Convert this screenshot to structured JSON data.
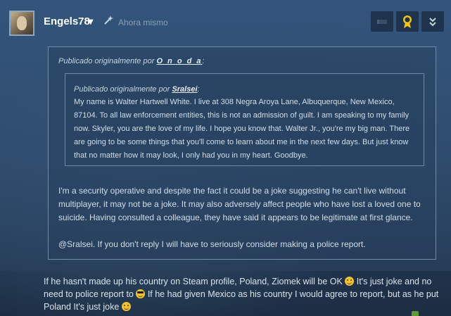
{
  "post": {
    "username": "Engels78",
    "timestamp": "Ahora mismo",
    "icons": {
      "status": "wand-icon",
      "rate": "thumbs-down-icon",
      "award": "award-ribbon-icon",
      "more": "chevron-double-down-icon"
    },
    "colors": {
      "award": "#f0c419",
      "username": "#ffffff",
      "timestamp": "#8b9fb2"
    }
  },
  "outer_quote": {
    "prefix": "Publicado originalmente por",
    "author": "O n o d a",
    "suffix": ":",
    "inner_quote": {
      "prefix": "Publicado originalmente por",
      "author": "Sralsei",
      "suffix": ":",
      "body": "My name is Walter Hartwell White. I live at 308 Negra Aroya Lane, Albuquerque, New Mexico, 87104. To all law enforcement entities, this is not an admission of guilt. I am speaking to my family now. Skyler, you are the love of my life. I hope you know that. Walter Jr., you're my big man. There are going to be some things that you'll come to learn about me in the next few days. But just know that no matter how it may look, I only had you in my heart. Goodbye."
    },
    "body_p1": "I'm a security operative and despite the fact it could be a joke suggesting he can't live without multiplayer, it may not be a joke. It may also adversely affect people who have lost a loved one to suicide. Having consulted a colleague, they have said it appears to be legitimate at first glance.",
    "body_p2": "@Sralsei. If you don't reply I will have to seriously consider making a police report."
  },
  "reply": {
    "part1": "If he hasn't made up his country on Steam profile, Poland, Ziomek will be OK ",
    "emoji1": "wink-emoji-icon",
    "part2": " It's just joke and no need to police report to ",
    "emoji2": "sunglasses-emoji-icon",
    "part3": " If he had given Mexico as his country I would agree to report, but as he put Poland It's just joke ",
    "emoji3": "smile-emoji-icon"
  }
}
